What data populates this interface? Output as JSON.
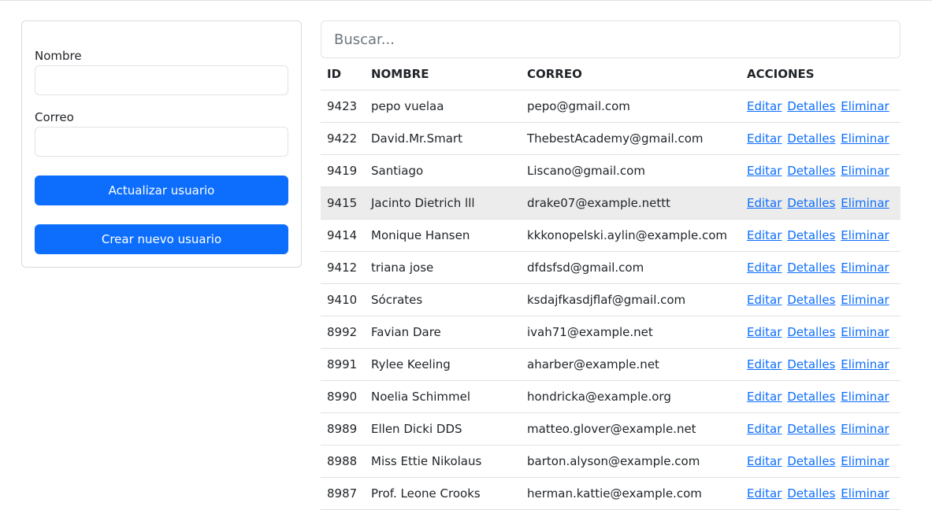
{
  "form": {
    "nombre_label": "Nombre",
    "nombre_value": "",
    "correo_label": "Correo",
    "correo_value": "",
    "update_button": "Actualizar usuario",
    "create_button": "Crear nuevo usuario"
  },
  "search": {
    "placeholder": "Buscar...",
    "value": ""
  },
  "table": {
    "headers": {
      "id": "ID",
      "nombre": "NOMBRE",
      "correo": "CORREO",
      "acciones": "ACCIONES"
    },
    "actions": {
      "edit": "Editar",
      "details": "Detalles",
      "delete": "Eliminar"
    },
    "hovered_row_id": "9415",
    "rows": [
      {
        "id": "9423",
        "nombre": "pepo vuelaa",
        "correo": "pepo@gmail.com"
      },
      {
        "id": "9422",
        "nombre": "David.Mr.Smart",
        "correo": "ThebestAcademy@gmail.com"
      },
      {
        "id": "9419",
        "nombre": "Santiago",
        "correo": "Liscano@gmail.com"
      },
      {
        "id": "9415",
        "nombre": "Jacinto Dietrich lll",
        "correo": "drake07@example.nettt"
      },
      {
        "id": "9414",
        "nombre": "Monique Hansen",
        "correo": "kkkonopelski.aylin@example.com"
      },
      {
        "id": "9412",
        "nombre": "triana jose",
        "correo": "dfdsfsd@gmail.com"
      },
      {
        "id": "9410",
        "nombre": "Sócrates",
        "correo": "ksdajfkasdjflaf@gmail.com"
      },
      {
        "id": "8992",
        "nombre": "Favian Dare",
        "correo": "ivah71@example.net"
      },
      {
        "id": "8991",
        "nombre": "Rylee Keeling",
        "correo": "aharber@example.net"
      },
      {
        "id": "8990",
        "nombre": "Noelia Schimmel",
        "correo": "hondricka@example.org"
      },
      {
        "id": "8989",
        "nombre": "Ellen Dicki DDS",
        "correo": "matteo.glover@example.net"
      },
      {
        "id": "8988",
        "nombre": "Miss Ettie Nikolaus",
        "correo": "barton.alyson@example.com"
      },
      {
        "id": "8987",
        "nombre": "Prof. Leone Crooks",
        "correo": "herman.kattie@example.com"
      }
    ]
  },
  "colors": {
    "primary": "#0d6efd",
    "hover_row": "#ececec",
    "border": "#dee2e6"
  }
}
